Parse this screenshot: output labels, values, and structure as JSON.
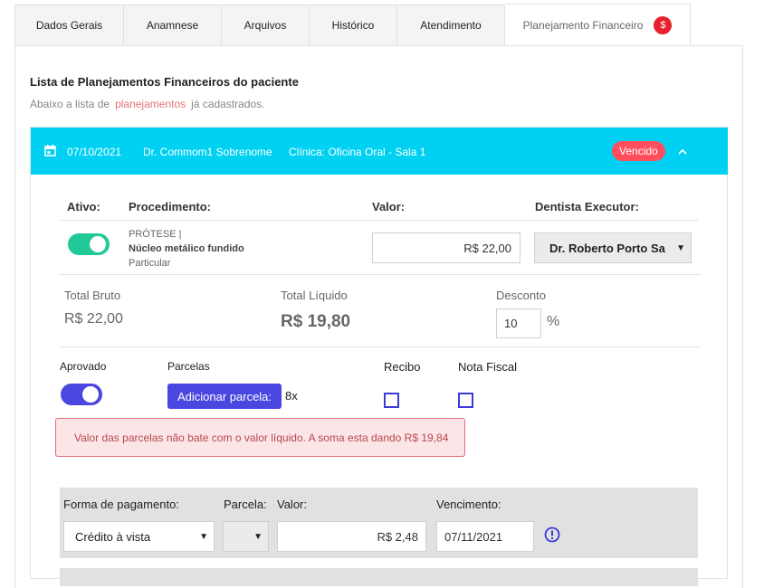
{
  "tabs": [
    {
      "label": "Dados Gerais"
    },
    {
      "label": "Anamnese"
    },
    {
      "label": "Arquivos"
    },
    {
      "label": "Histórico"
    },
    {
      "label": "Atendimento"
    },
    {
      "label": "Planejamento Financeiro",
      "badge": "$"
    }
  ],
  "page": {
    "title": "Lista de Planejamentos Financeiros do paciente",
    "subtitle_pre": "Abaixo a lista de",
    "subtitle_link": "planejamentos",
    "subtitle_post": "já cadastrados."
  },
  "plan": {
    "date": "07/10/2021",
    "doctor": "Dr. Commom1 Sobrenome",
    "clinic": "Clínica: Oficina Oral - Sala 1",
    "status": "Vencido",
    "columns": {
      "ativo": "Ativo:",
      "procedimento": "Procedimento:",
      "valor": "Valor:",
      "dentista": "Dentista Executor:"
    },
    "item": {
      "active": true,
      "category": "PRÓTESE |",
      "name": "Núcleo metálico fundido",
      "type": "Particular",
      "value": "R$ 22,00",
      "dentist": "Dr. Roberto Porto Sa"
    },
    "totals": {
      "bruto_label": "Total Bruto",
      "bruto_value": "R$ 22,00",
      "liquido_label": "Total Líquido",
      "liquido_value": "R$ 19,80",
      "desconto_label": "Desconto",
      "desconto_value": "10",
      "desconto_unit": "%"
    },
    "aprovado_label": "Aprovado",
    "aprovado": true,
    "parcelas_label": "Parcelas",
    "add_parcela_label": "Adicionar parcela:",
    "parcelas_count": "8x",
    "recibo_label": "Recibo",
    "nota_fiscal_label": "Nota Fiscal",
    "alert": "Valor das parcelas não bate com o valor líquido. A soma esta dando R$ 19,84",
    "payment": {
      "forma_label": "Forma de pagamento:",
      "parcela_label": "Parcela:",
      "valor_label": "Valor:",
      "vencimento_label": "Vencimento:",
      "forma_value": "Crédito à vista",
      "parcela_value": "",
      "valor_value": "R$ 2,48",
      "vencimento_value": "07/11/2021"
    }
  },
  "colors": {
    "header": "#00d1f2",
    "badge": "#ff4f5e",
    "toggle_active": "#20c997",
    "toggle_approved": "#4a46e0",
    "primary": "#4a46e0"
  },
  "icons": [
    "dollar-icon",
    "calendar-icon",
    "chevron-up-icon",
    "chevron-down-icon",
    "info-icon"
  ]
}
